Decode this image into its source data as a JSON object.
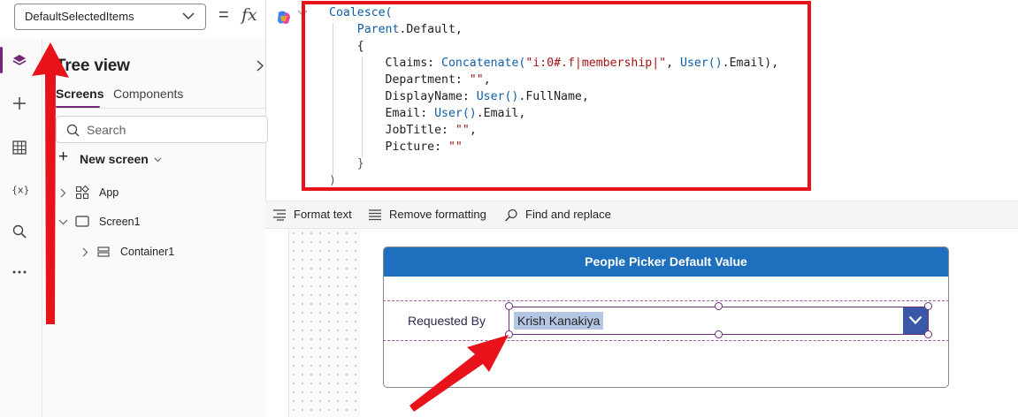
{
  "formula_bar": {
    "property": "DefaultSelectedItems",
    "equals": "=",
    "fx": "fx"
  },
  "formula_lines": [
    {
      "parts": [
        {
          "t": "Coalesce(",
          "c": "k"
        }
      ]
    },
    {
      "parts": [
        {
          "t": "    Parent",
          "c": "k"
        },
        {
          "t": ".Default,",
          "c": ""
        }
      ]
    },
    {
      "parts": [
        {
          "t": "    {",
          "c": ""
        }
      ]
    },
    {
      "parts": [
        {
          "t": "        Claims: ",
          "c": ""
        },
        {
          "t": "Concatenate(",
          "c": "k"
        },
        {
          "t": "\"i:0#.f|membership|\"",
          "c": "s"
        },
        {
          "t": ", ",
          "c": ""
        },
        {
          "t": "User()",
          "c": "k"
        },
        {
          "t": ".Email),",
          "c": ""
        }
      ]
    },
    {
      "parts": [
        {
          "t": "        Department: ",
          "c": ""
        },
        {
          "t": "\"\"",
          "c": "s"
        },
        {
          "t": ",",
          "c": ""
        }
      ]
    },
    {
      "parts": [
        {
          "t": "        DisplayName: ",
          "c": ""
        },
        {
          "t": "User()",
          "c": "k"
        },
        {
          "t": ".FullName,",
          "c": ""
        }
      ]
    },
    {
      "parts": [
        {
          "t": "        Email: ",
          "c": ""
        },
        {
          "t": "User()",
          "c": "k"
        },
        {
          "t": ".Email,",
          "c": ""
        }
      ]
    },
    {
      "parts": [
        {
          "t": "        JobTitle: ",
          "c": ""
        },
        {
          "t": "\"\"",
          "c": "s"
        },
        {
          "t": ",",
          "c": ""
        }
      ]
    },
    {
      "parts": [
        {
          "t": "        Picture: ",
          "c": ""
        },
        {
          "t": "\"\"",
          "c": "s"
        }
      ]
    },
    {
      "parts": [
        {
          "t": "    }",
          "c": "g"
        }
      ]
    },
    {
      "parts": [
        {
          "t": ")",
          "c": "g"
        }
      ]
    }
  ],
  "format_toolbar": {
    "format_text": "Format text",
    "remove_formatting": "Remove formatting",
    "find_replace": "Find and replace"
  },
  "tree": {
    "title": "Tree view",
    "tabs": [
      "Screens",
      "Components"
    ],
    "search_placeholder": "Search",
    "new_screen": "New screen",
    "items": {
      "app": "App",
      "screen": "Screen1",
      "container": "Container1"
    }
  },
  "form": {
    "header": "People Picker Default Value",
    "label": "Requested By",
    "selected_person": "Krish Kanakiya"
  },
  "colors": {
    "accent": "#742774",
    "header_blue": "#1f6fbf",
    "highlight_red": "#e8131a",
    "combo_button": "#3a58a8"
  }
}
